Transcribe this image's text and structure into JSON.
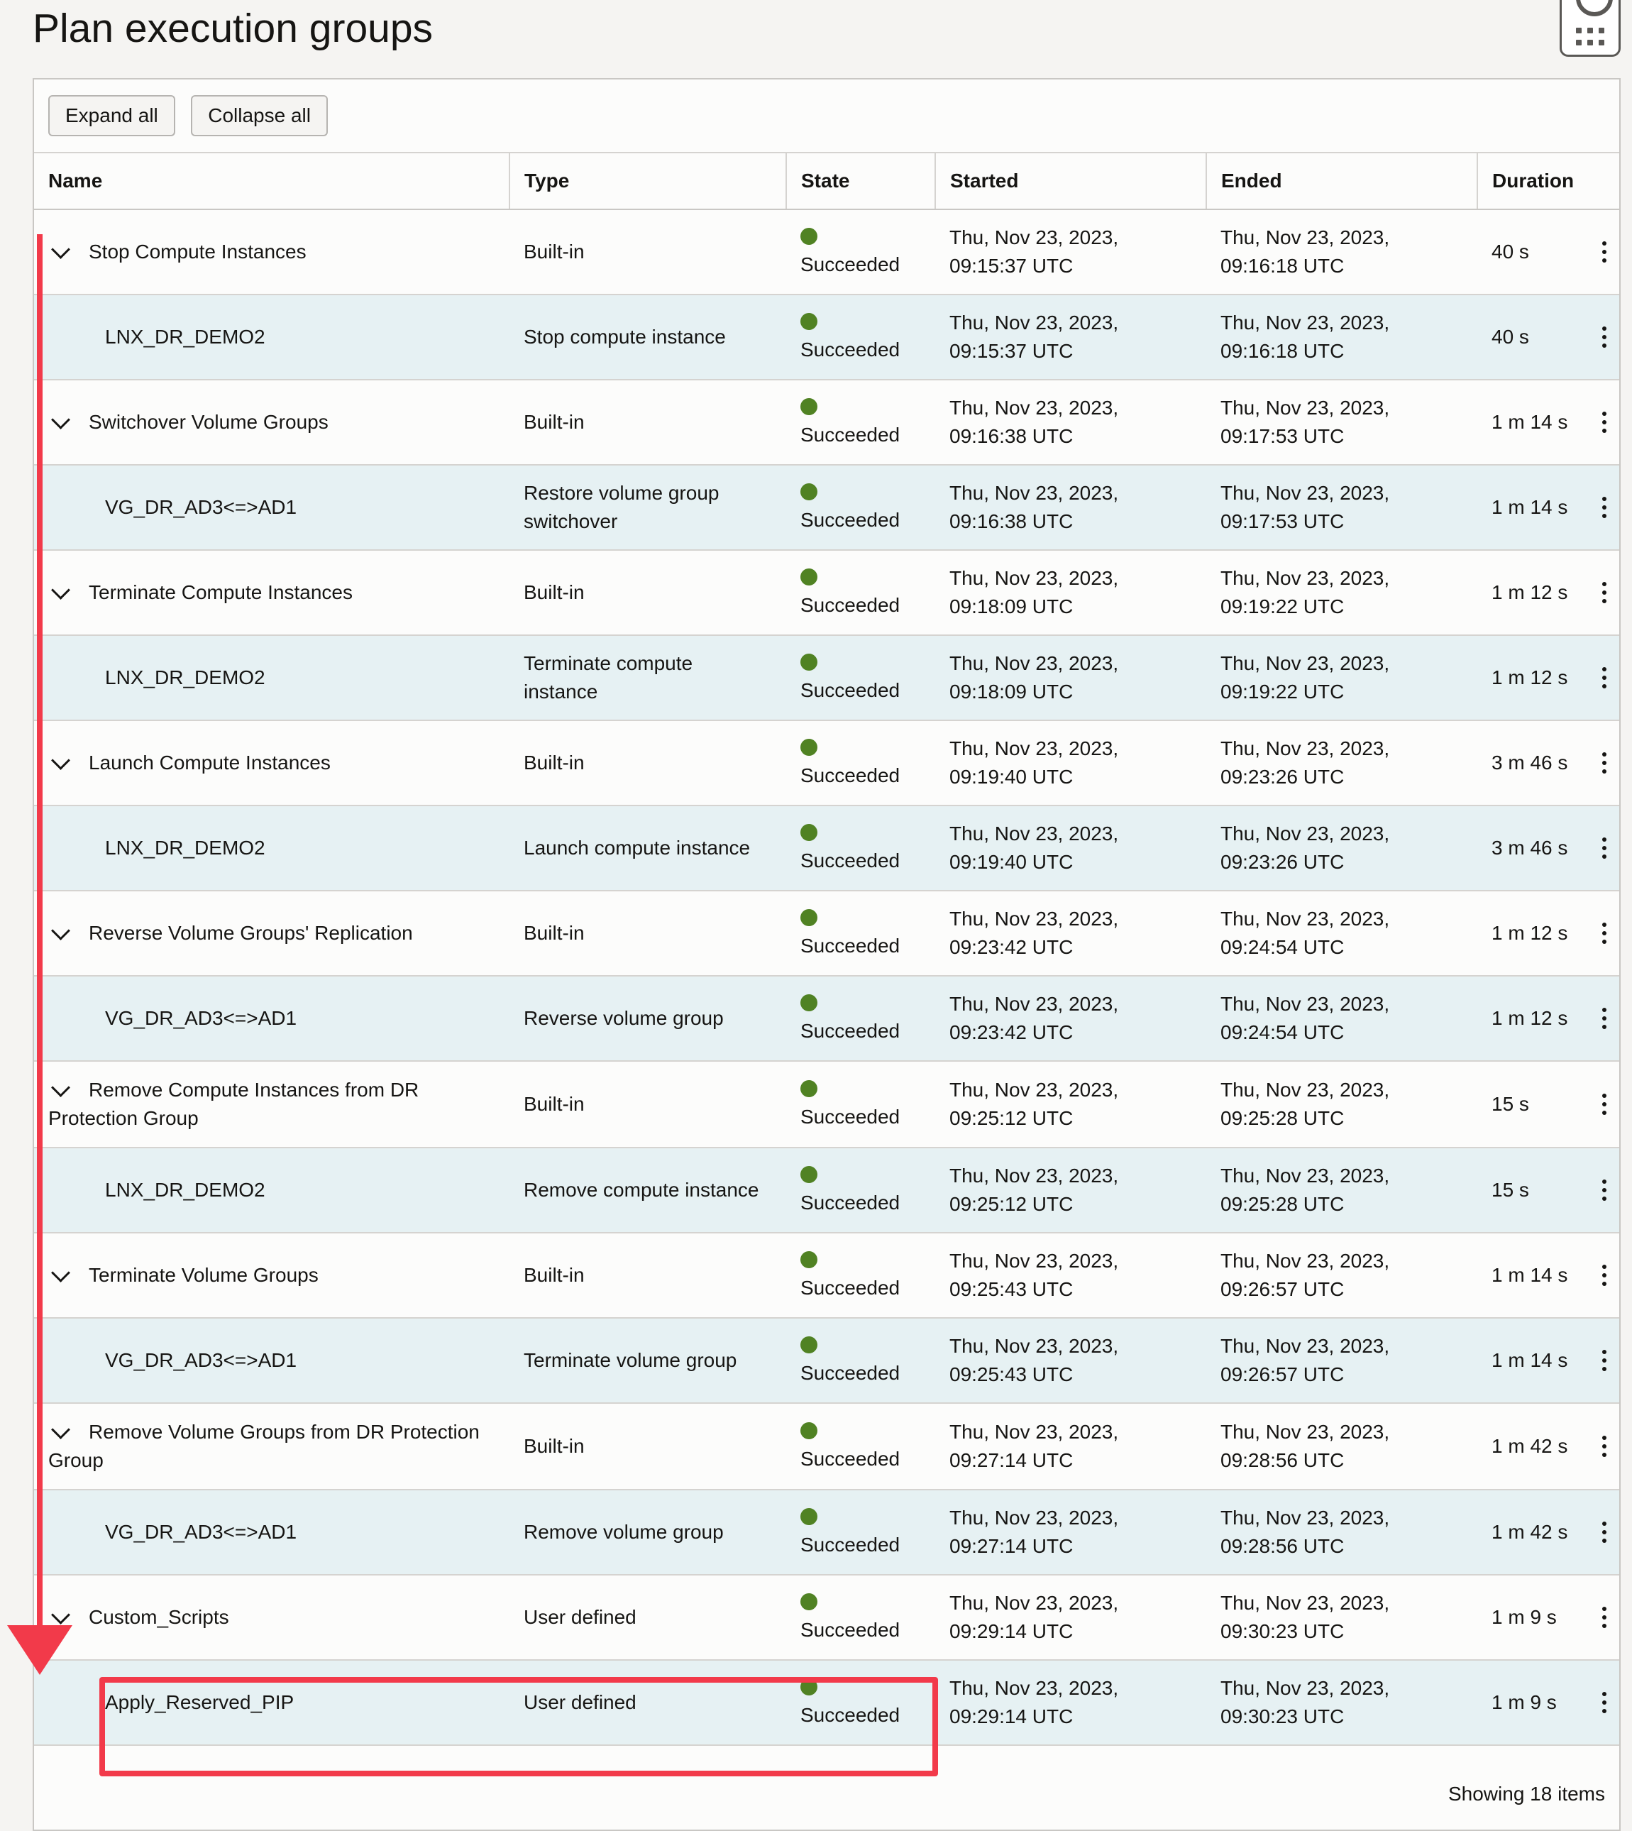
{
  "page": {
    "title": "Plan execution groups"
  },
  "toolbar": {
    "expand_label": "Expand all",
    "collapse_label": "Collapse all"
  },
  "table": {
    "columns": [
      "Name",
      "Type",
      "State",
      "Started",
      "Ended",
      "Duration"
    ],
    "rows": [
      {
        "level": "group",
        "name": "Stop Compute Instances",
        "type": "Built-in",
        "state": "Succeeded",
        "started_date": "Thu, Nov 23, 2023,",
        "started_time": "09:15:37 UTC",
        "ended_date": "Thu, Nov 23, 2023,",
        "ended_time": "09:16:18 UTC",
        "duration": "40 s"
      },
      {
        "level": "step",
        "name": "LNX_DR_DEMO2",
        "type": "Stop compute instance",
        "state": "Succeeded",
        "started_date": "Thu, Nov 23, 2023,",
        "started_time": "09:15:37 UTC",
        "ended_date": "Thu, Nov 23, 2023,",
        "ended_time": "09:16:18 UTC",
        "duration": "40 s"
      },
      {
        "level": "group",
        "name": "Switchover Volume Groups",
        "type": "Built-in",
        "state": "Succeeded",
        "started_date": "Thu, Nov 23, 2023,",
        "started_time": "09:16:38 UTC",
        "ended_date": "Thu, Nov 23, 2023,",
        "ended_time": "09:17:53 UTC",
        "duration": "1 m 14 s"
      },
      {
        "level": "step",
        "name": "VG_DR_AD3<=>AD1",
        "type": "Restore volume group switchover",
        "state": "Succeeded",
        "started_date": "Thu, Nov 23, 2023,",
        "started_time": "09:16:38 UTC",
        "ended_date": "Thu, Nov 23, 2023,",
        "ended_time": "09:17:53 UTC",
        "duration": "1 m 14 s"
      },
      {
        "level": "group",
        "name": "Terminate Compute Instances",
        "type": "Built-in",
        "state": "Succeeded",
        "started_date": "Thu, Nov 23, 2023,",
        "started_time": "09:18:09 UTC",
        "ended_date": "Thu, Nov 23, 2023,",
        "ended_time": "09:19:22 UTC",
        "duration": "1 m 12 s"
      },
      {
        "level": "step",
        "name": "LNX_DR_DEMO2",
        "type": "Terminate compute instance",
        "state": "Succeeded",
        "started_date": "Thu, Nov 23, 2023,",
        "started_time": "09:18:09 UTC",
        "ended_date": "Thu, Nov 23, 2023,",
        "ended_time": "09:19:22 UTC",
        "duration": "1 m 12 s"
      },
      {
        "level": "group",
        "name": "Launch Compute Instances",
        "type": "Built-in",
        "state": "Succeeded",
        "started_date": "Thu, Nov 23, 2023,",
        "started_time": "09:19:40 UTC",
        "ended_date": "Thu, Nov 23, 2023,",
        "ended_time": "09:23:26 UTC",
        "duration": "3 m 46 s"
      },
      {
        "level": "step",
        "name": "LNX_DR_DEMO2",
        "type": "Launch compute instance",
        "state": "Succeeded",
        "started_date": "Thu, Nov 23, 2023,",
        "started_time": "09:19:40 UTC",
        "ended_date": "Thu, Nov 23, 2023,",
        "ended_time": "09:23:26 UTC",
        "duration": "3 m 46 s"
      },
      {
        "level": "group",
        "name": "Reverse Volume Groups' Replication",
        "type": "Built-in",
        "state": "Succeeded",
        "started_date": "Thu, Nov 23, 2023,",
        "started_time": "09:23:42 UTC",
        "ended_date": "Thu, Nov 23, 2023,",
        "ended_time": "09:24:54 UTC",
        "duration": "1 m 12 s"
      },
      {
        "level": "step",
        "name": "VG_DR_AD3<=>AD1",
        "type": "Reverse volume group",
        "state": "Succeeded",
        "started_date": "Thu, Nov 23, 2023,",
        "started_time": "09:23:42 UTC",
        "ended_date": "Thu, Nov 23, 2023,",
        "ended_time": "09:24:54 UTC",
        "duration": "1 m 12 s"
      },
      {
        "level": "group",
        "name": "Remove Compute Instances from DR Protection Group",
        "type": "Built-in",
        "state": "Succeeded",
        "started_date": "Thu, Nov 23, 2023,",
        "started_time": "09:25:12 UTC",
        "ended_date": "Thu, Nov 23, 2023,",
        "ended_time": "09:25:28 UTC",
        "duration": "15 s"
      },
      {
        "level": "step",
        "name": "LNX_DR_DEMO2",
        "type": "Remove compute instance",
        "state": "Succeeded",
        "started_date": "Thu, Nov 23, 2023,",
        "started_time": "09:25:12 UTC",
        "ended_date": "Thu, Nov 23, 2023,",
        "ended_time": "09:25:28 UTC",
        "duration": "15 s"
      },
      {
        "level": "group",
        "name": "Terminate Volume Groups",
        "type": "Built-in",
        "state": "Succeeded",
        "started_date": "Thu, Nov 23, 2023,",
        "started_time": "09:25:43 UTC",
        "ended_date": "Thu, Nov 23, 2023,",
        "ended_time": "09:26:57 UTC",
        "duration": "1 m 14 s"
      },
      {
        "level": "step",
        "name": "VG_DR_AD3<=>AD1",
        "type": "Terminate volume group",
        "state": "Succeeded",
        "started_date": "Thu, Nov 23, 2023,",
        "started_time": "09:25:43 UTC",
        "ended_date": "Thu, Nov 23, 2023,",
        "ended_time": "09:26:57 UTC",
        "duration": "1 m 14 s"
      },
      {
        "level": "group",
        "name": "Remove Volume Groups from DR Protection Group",
        "type": "Built-in",
        "state": "Succeeded",
        "started_date": "Thu, Nov 23, 2023,",
        "started_time": "09:27:14 UTC",
        "ended_date": "Thu, Nov 23, 2023,",
        "ended_time": "09:28:56 UTC",
        "duration": "1 m 42 s"
      },
      {
        "level": "step",
        "name": "VG_DR_AD3<=>AD1",
        "type": "Remove volume group",
        "state": "Succeeded",
        "started_date": "Thu, Nov 23, 2023,",
        "started_time": "09:27:14 UTC",
        "ended_date": "Thu, Nov 23, 2023,",
        "ended_time": "09:28:56 UTC",
        "duration": "1 m 42 s"
      },
      {
        "level": "group",
        "name": "Custom_Scripts",
        "type": "User defined",
        "state": "Succeeded",
        "started_date": "Thu, Nov 23, 2023,",
        "started_time": "09:29:14 UTC",
        "ended_date": "Thu, Nov 23, 2023,",
        "ended_time": "09:30:23 UTC",
        "duration": "1 m 9 s"
      },
      {
        "level": "step",
        "name": "Apply_Reserved_PIP",
        "type": "User defined",
        "state": "Succeeded",
        "started_date": "Thu, Nov 23, 2023,",
        "started_time": "09:29:14 UTC",
        "ended_date": "Thu, Nov 23, 2023,",
        "ended_time": "09:30:23 UTC",
        "duration": "1 m 9 s"
      }
    ]
  },
  "footer": {
    "count_text": "Showing 18 items"
  },
  "colors": {
    "success": "#508223",
    "child_row": "#e6f1f3",
    "annotation": "#f23a4a"
  },
  "icons": {
    "help": "help-ring-icon",
    "apps": "app-grid-icon",
    "expand": "chevron-down-icon",
    "actions": "kebab-menu-icon"
  }
}
